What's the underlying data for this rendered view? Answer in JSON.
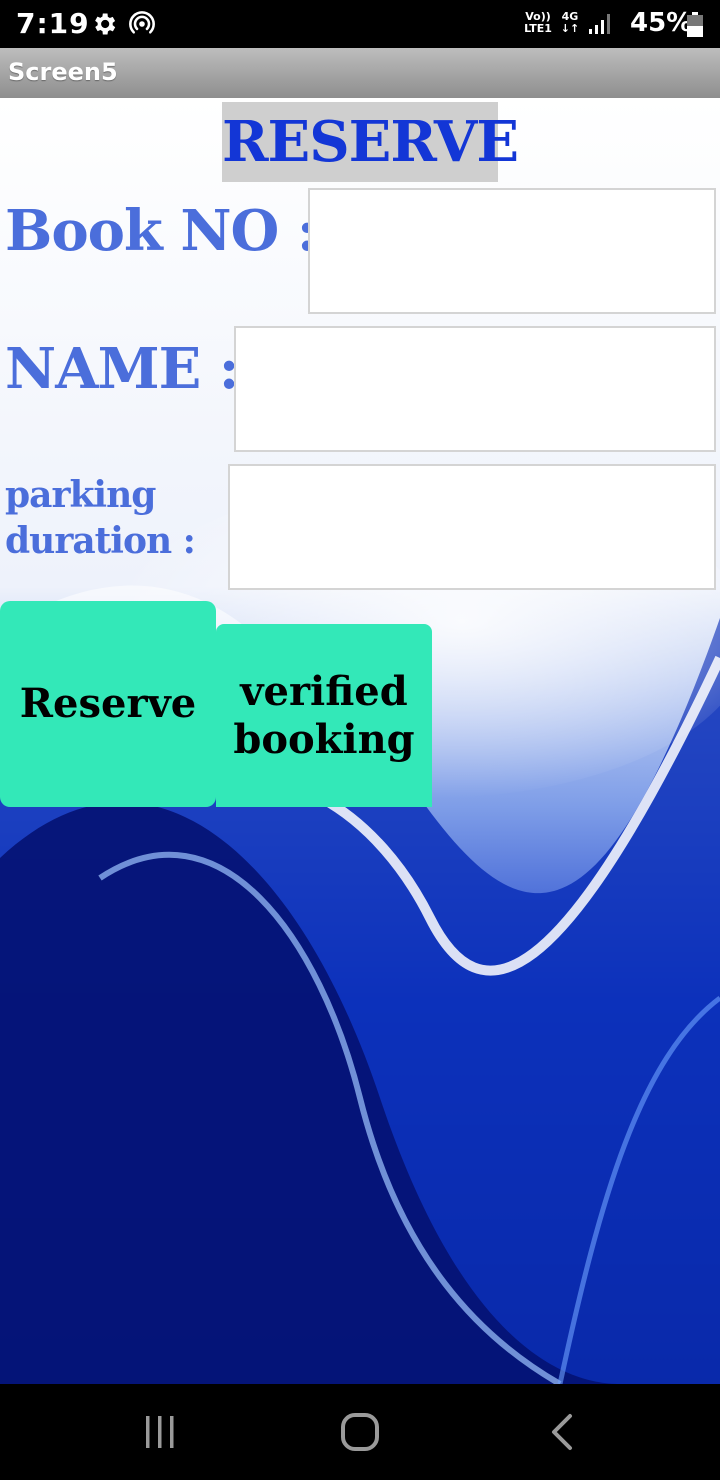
{
  "status_bar": {
    "time": "7:19",
    "volte_top": "Vo))",
    "volte_bottom": "LTE1",
    "network_top": "4G",
    "network_bottom": "↓↑",
    "battery": "45%",
    "icons": [
      "gear-icon",
      "hotspot-icon",
      "signal-icon",
      "battery-icon"
    ]
  },
  "app": {
    "title": "Screen5"
  },
  "form": {
    "heading": "RESERVE",
    "book_no_label": "Book NO :",
    "book_no_value": "",
    "name_label": "NAME :",
    "name_value": "",
    "duration_label_line1": "parking",
    "duration_label_line2": "duration :",
    "duration_value": ""
  },
  "buttons": {
    "reserve_label": "Reserve",
    "verified_line1": "verified",
    "verified_line2": "booking"
  },
  "colors": {
    "heading_text": "#1336d6",
    "label_text": "#4b6edb",
    "button_bg": "#33e8b8",
    "title_bar": "#a5a5a5"
  },
  "nav_bar": {
    "icons": [
      "recent-apps-icon",
      "home-icon",
      "back-icon"
    ]
  }
}
